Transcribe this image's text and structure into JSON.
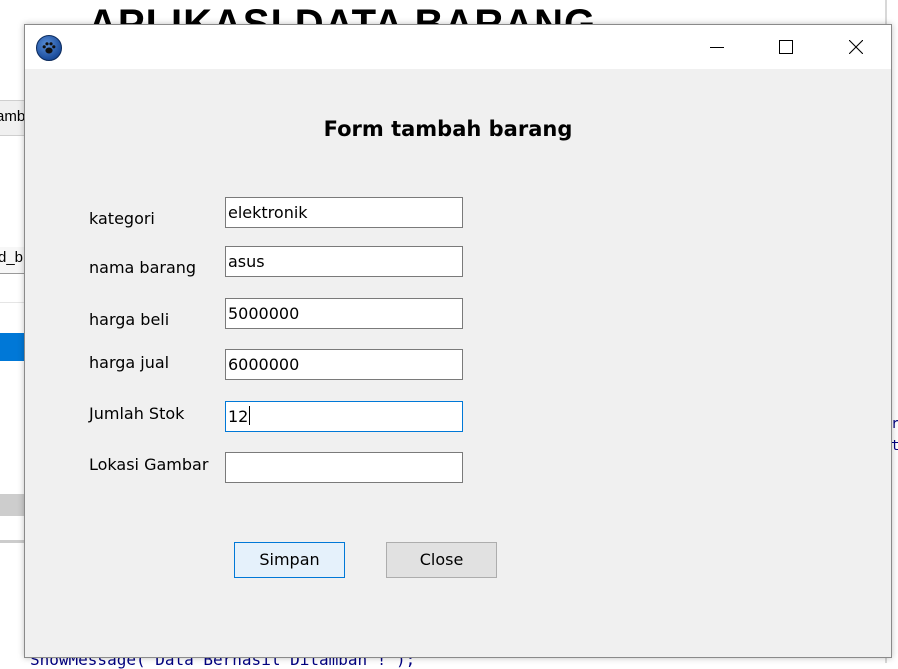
{
  "background_window": {
    "title_text": "APLIKASI DATA BARANG",
    "tab_label_fragment": "amb",
    "column_header_fragment": "d_b",
    "code_line": "ShowMessage('Data Berhasil Ditambah !');",
    "code_right_1": "r",
    "code_right_2": "t"
  },
  "dialog": {
    "form_title": "Form tambah barang",
    "fields": [
      {
        "label": "kategori",
        "value": "elektronik"
      },
      {
        "label": "nama barang",
        "value": "asus"
      },
      {
        "label": "harga beli",
        "value": "5000000"
      },
      {
        "label": "harga jual",
        "value": "6000000"
      },
      {
        "label": "Jumlah Stok",
        "value": "12"
      },
      {
        "label": "Lokasi Gambar",
        "value": ""
      }
    ],
    "buttons": {
      "save_label": "Simpan",
      "close_label": "Close"
    },
    "icons": {
      "app": "paw-icon",
      "minimize": "minimize-icon",
      "maximize": "maximize-icon",
      "close": "close-icon"
    },
    "colors": {
      "focus_border": "#0078d7",
      "dialog_bg": "#f0f0f0",
      "primary_button_bg": "#e5f1fb"
    }
  }
}
